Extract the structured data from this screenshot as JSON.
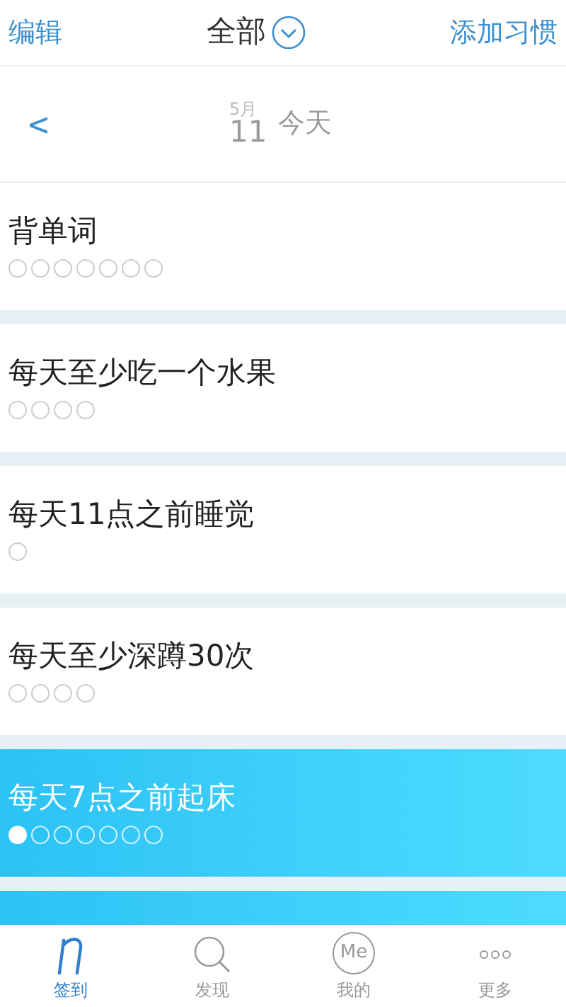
{
  "header": {
    "edit": "编辑",
    "title": "全部",
    "add": "添加习惯"
  },
  "date_bar": {
    "back": "<",
    "month": "5月",
    "day": "11",
    "label": "今天"
  },
  "habits": [
    {
      "name": "背单词",
      "highlighted": false,
      "marks": [
        {
          "done": false
        },
        {
          "done": false
        },
        {
          "done": false
        },
        {
          "done": false
        },
        {
          "done": false
        },
        {
          "done": false
        },
        {
          "done": false
        }
      ]
    },
    {
      "name": "每天至少吃一个水果",
      "highlighted": false,
      "marks": [
        {
          "done": false
        },
        {
          "done": false
        },
        {
          "done": false
        },
        {
          "done": false
        }
      ]
    },
    {
      "name": "每天11点之前睡觉",
      "highlighted": false,
      "marks": [
        {
          "done": false
        }
      ]
    },
    {
      "name": "每天至少深蹲30次",
      "highlighted": false,
      "marks": [
        {
          "done": false
        },
        {
          "done": false
        },
        {
          "done": false
        },
        {
          "done": false
        }
      ]
    },
    {
      "name": "每天7点之前起床",
      "highlighted": true,
      "marks": [
        {
          "done": true
        },
        {
          "done": false
        },
        {
          "done": false
        },
        {
          "done": false
        },
        {
          "done": false
        },
        {
          "done": false
        },
        {
          "done": false
        }
      ]
    },
    {
      "highlighted": true
    }
  ],
  "tabs": [
    {
      "kind": "checkin",
      "label": "签到",
      "selected": true
    },
    {
      "kind": "discover",
      "label": "发现",
      "selected": false
    },
    {
      "kind": "me",
      "label": "我的",
      "icon_text": "Me",
      "selected": false
    },
    {
      "kind": "more",
      "label": "更多",
      "selected": false
    }
  ]
}
